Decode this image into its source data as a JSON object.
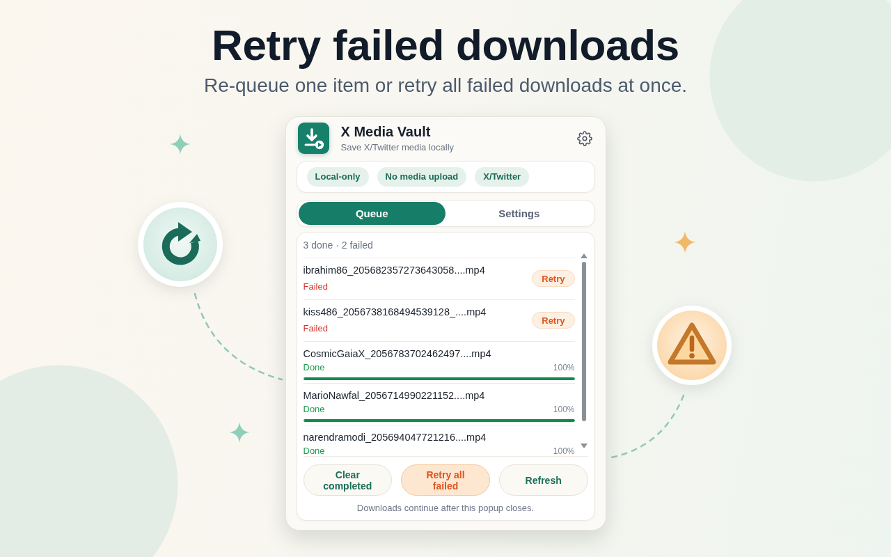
{
  "hero": {
    "title": "Retry failed downloads",
    "subtitle": "Re-queue one item or retry all failed downloads at once."
  },
  "popup": {
    "app": {
      "name": "X Media Vault",
      "tagline": "Save X/Twitter media locally"
    },
    "chips": [
      "Local-only",
      "No media upload",
      "X/Twitter"
    ],
    "tabs": [
      {
        "label": "Queue",
        "selected": true
      },
      {
        "label": "Settings",
        "selected": false
      }
    ],
    "queue": {
      "summary": "3 done · 2 failed",
      "items": [
        {
          "name": "ibrahim86_205682357273643058....mp4",
          "status": "Failed",
          "kind": "failed",
          "action": "Retry"
        },
        {
          "name": "kiss486_2056738168494539128_....mp4",
          "status": "Failed",
          "kind": "failed",
          "action": "Retry"
        },
        {
          "name": "CosmicGaiaX_2056783702462497....mp4",
          "status": "Done",
          "kind": "done",
          "percent": "100%",
          "level": 1
        },
        {
          "name": "MarioNawfal_2056714990221152....mp4",
          "status": "Done",
          "kind": "done",
          "percent": "100%",
          "level": 1
        },
        {
          "name": "narendramodi_205694047721216....mp4",
          "status": "Done",
          "kind": "done",
          "percent": "100%"
        }
      ]
    },
    "buttons": [
      {
        "label": "Clear completed",
        "kind": "neutral"
      },
      {
        "label": "Retry all failed",
        "kind": "warning"
      },
      {
        "label": "Refresh",
        "kind": "neutral"
      }
    ],
    "footer": "Downloads continue after this popup closes."
  }
}
